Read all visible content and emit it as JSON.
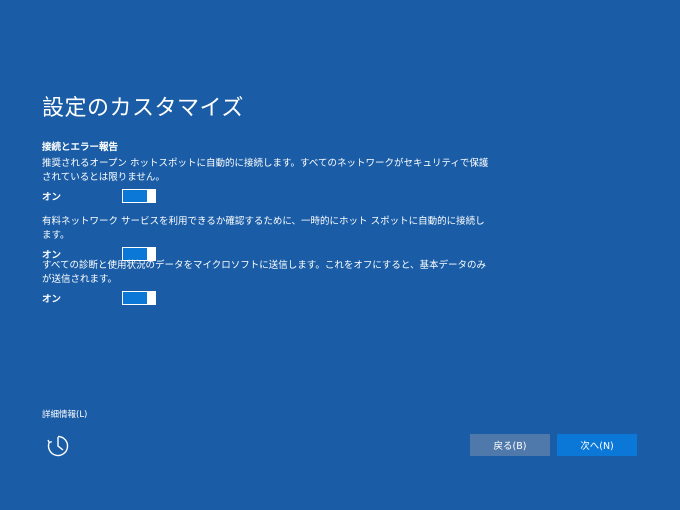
{
  "page_title": "設定のカスタマイズ",
  "section_heading": "接続とエラー報告",
  "settings": [
    {
      "description": "推奨されるオープン ホットスポットに自動的に接続します。すべてのネットワークがセキュリティで保護されているとは限りません。",
      "state_label": "オン",
      "enabled": true
    },
    {
      "description": "有料ネットワーク サービスを利用できるか確認するために、一時的にホット スポットに自動的に接続します。",
      "state_label": "オン",
      "enabled": true
    },
    {
      "description": "すべての診断と使用状況のデータをマイクロソフトに送信します。これをオフにすると、基本データのみが送信されます。",
      "state_label": "オン",
      "enabled": true
    }
  ],
  "details_link": "詳細情報(L)",
  "accessibility_icon": "ease-of-access-icon",
  "buttons": {
    "back_label": "戻る(B)",
    "next_label": "次へ(N)"
  },
  "colors": {
    "background": "#1a5da6",
    "toggle_on": "#0b78d8",
    "back_button": "#5079ab",
    "next_button": "#0b78d8"
  }
}
